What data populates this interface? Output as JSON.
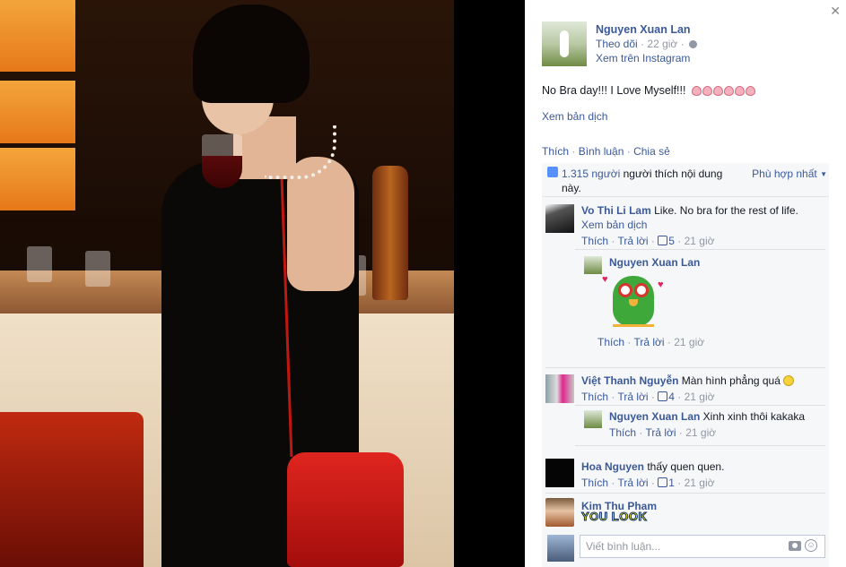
{
  "post": {
    "author": "Nguyen Xuan Lan",
    "follow_label": "Theo dõi",
    "separator": "·",
    "time": "22 giờ",
    "instagram_link": "Xem trên Instagram",
    "text": "No Bra day!!! I Love Myself!!!",
    "translate_link": "Xem bản dịch",
    "actions": {
      "like": "Thích",
      "comment": "Bình luận",
      "share": "Chia sẻ",
      "dot": " · "
    },
    "likes": {
      "count": "1.315 người",
      "rest": " người thích nội dung này.",
      "sort": "Phù hợp nhất"
    }
  },
  "comments": [
    {
      "name": "Vo Thi Li Lam",
      "text": " Like. No bra for the rest of life.",
      "translate": "Xem bản dịch",
      "like": "Thích",
      "reply": "Trả lời",
      "likes": "5",
      "time": "21 giờ",
      "replies": [
        {
          "name": "Nguyen Xuan Lan",
          "text": "",
          "like": "Thích",
          "reply": "Trả lời",
          "time": "21 giờ",
          "sticker": "owl-heart-eyes"
        }
      ]
    },
    {
      "name": "Việt Thanh Nguyễn",
      "text": " Màn hình phẳng quá",
      "like": "Thích",
      "reply": "Trả lời",
      "likes": "4",
      "time": "21 giờ",
      "replies": [
        {
          "name": "Nguyen Xuan Lan",
          "text": " Xinh xinh thôi kakaka",
          "like": "Thích",
          "reply": "Trả lời",
          "time": "21 giờ"
        }
      ]
    },
    {
      "name": "Hoa Nguyen",
      "text": " thấy quen quen.",
      "like": "Thích",
      "reply": "Trả lời",
      "likes": "1",
      "time": "21 giờ"
    },
    {
      "name": "Kim Thu Pham",
      "sticker_text": "YOU LOOK"
    }
  ],
  "composer": {
    "placeholder": "Viết bình luận..."
  },
  "icons": [
    "close-icon",
    "globe-icon",
    "heart-emoji-icon",
    "thumbs-up-icon",
    "camera-icon",
    "smiley-icon"
  ],
  "colors": {
    "link": "#3b5998",
    "muted": "#9197a3",
    "panel_bg": "#f6f7f9"
  }
}
